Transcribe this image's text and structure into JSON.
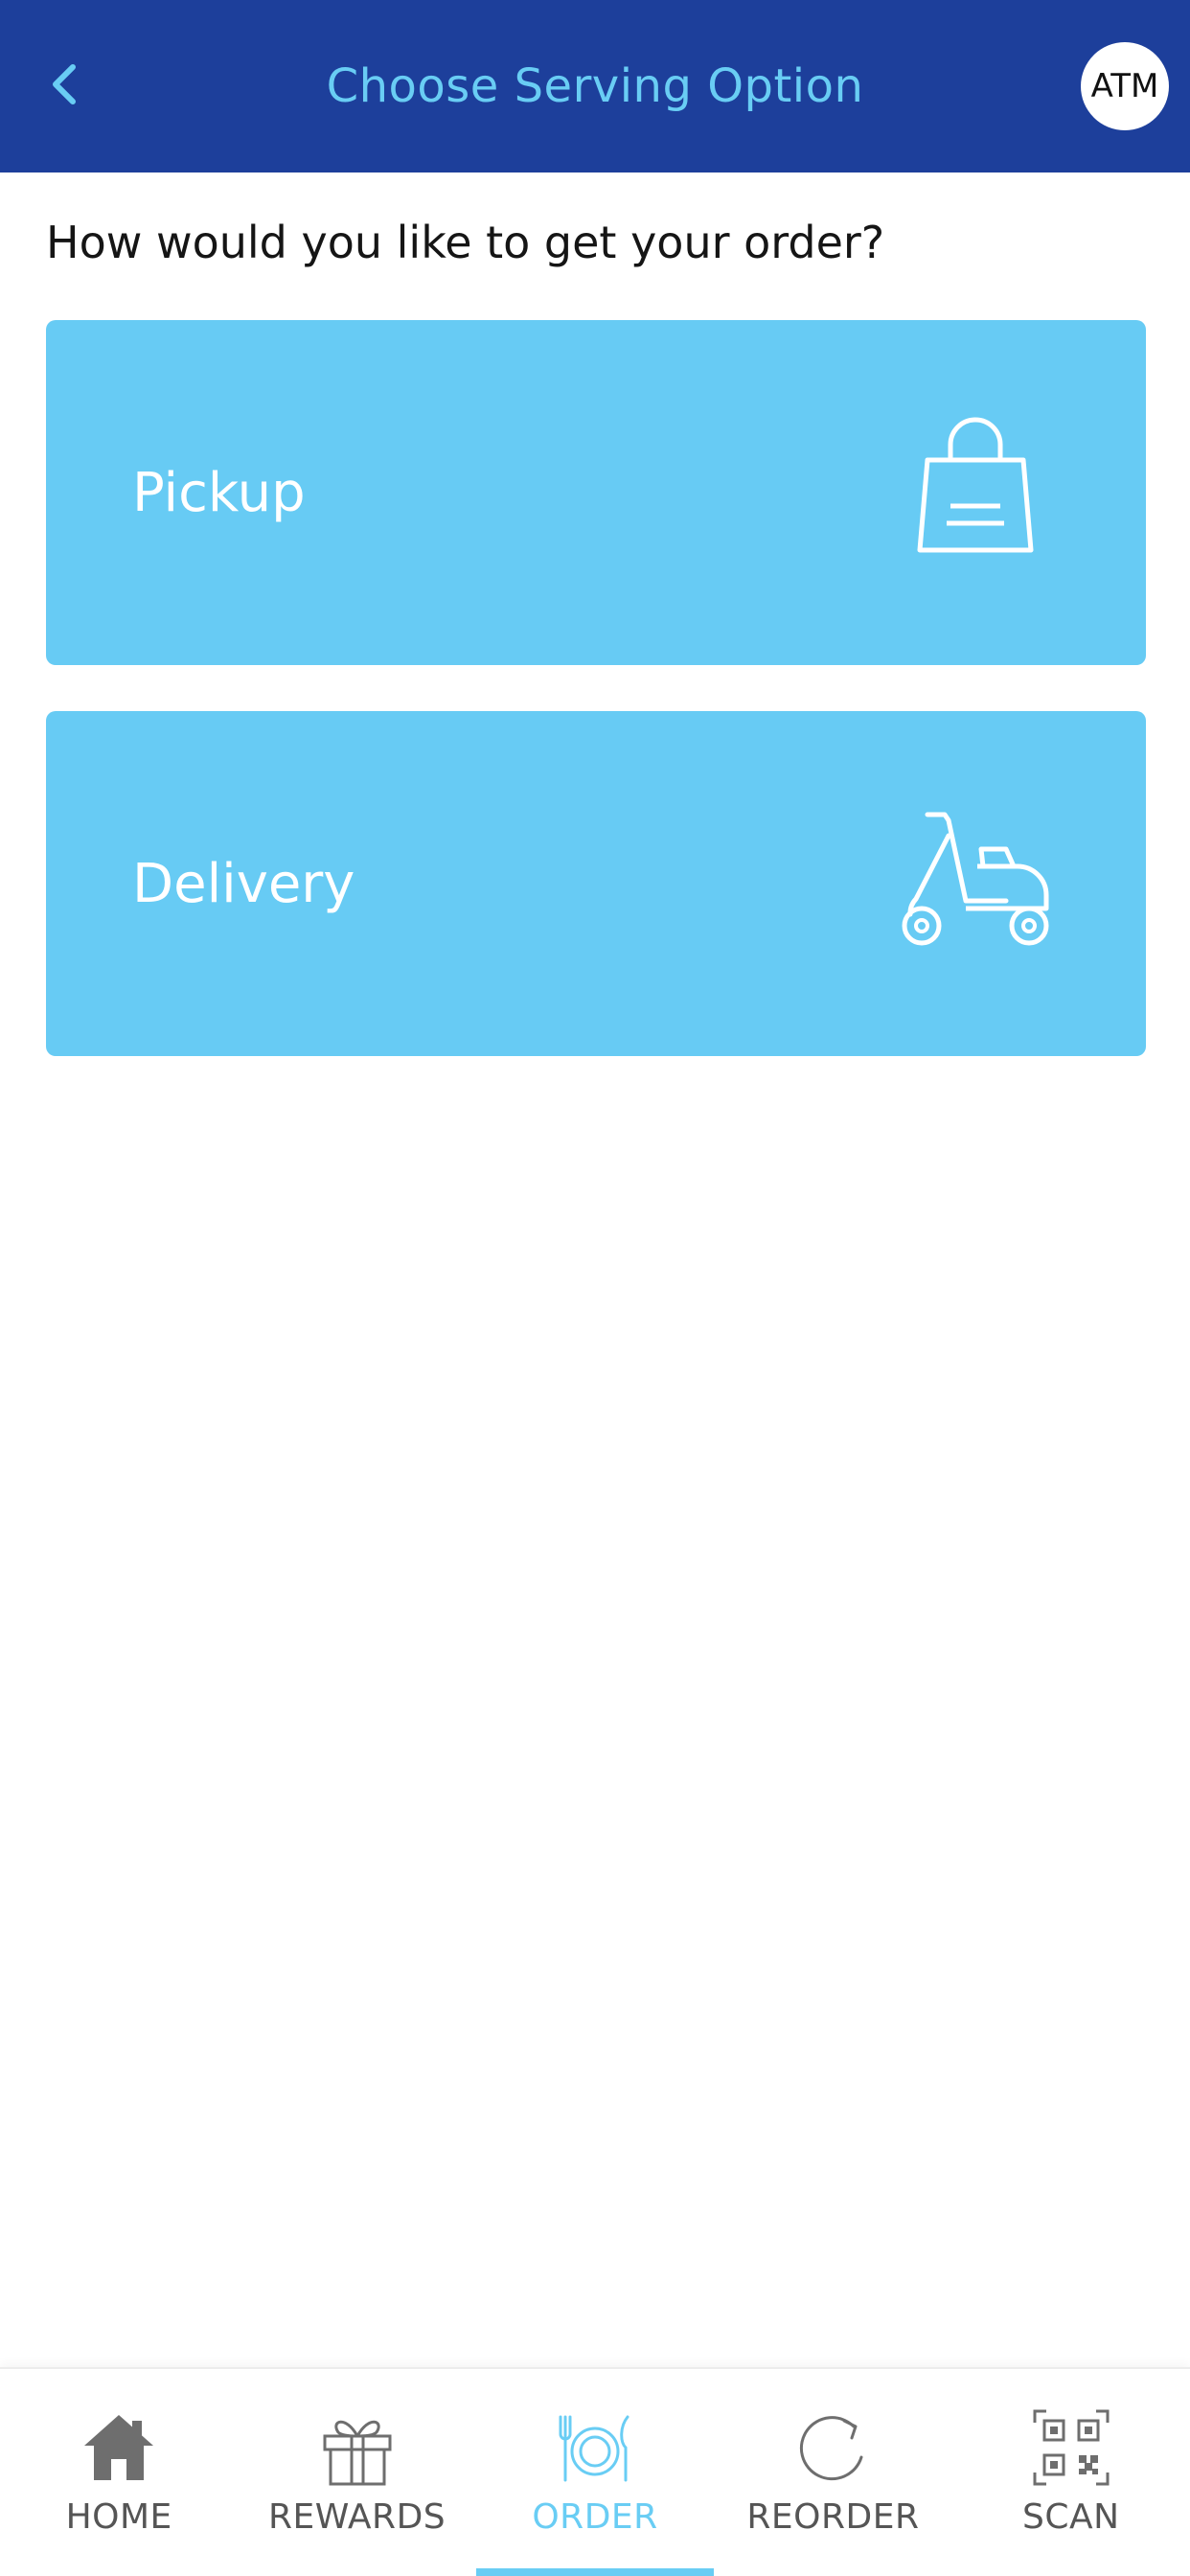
{
  "header": {
    "title": "Choose Serving Option",
    "back_icon": "chevron-left-icon",
    "avatar_initials": "ATM"
  },
  "main": {
    "question": "How would you like to get your order?",
    "options": [
      {
        "label": "Pickup",
        "icon": "shopping-bag-icon"
      },
      {
        "label": "Delivery",
        "icon": "scooter-icon"
      }
    ]
  },
  "bottom_nav": {
    "active": "ORDER",
    "items": [
      {
        "label": "HOME",
        "icon": "home-icon"
      },
      {
        "label": "REWARDS",
        "icon": "gift-icon"
      },
      {
        "label": "ORDER",
        "icon": "plate-cutlery-icon"
      },
      {
        "label": "REORDER",
        "icon": "refresh-icon"
      },
      {
        "label": "SCAN",
        "icon": "qr-code-icon"
      }
    ]
  },
  "colors": {
    "header_bg": "#1d3f9b",
    "accent": "#69cdf4",
    "card_bg": "#67cbf4",
    "nav_inactive": "#555555"
  }
}
